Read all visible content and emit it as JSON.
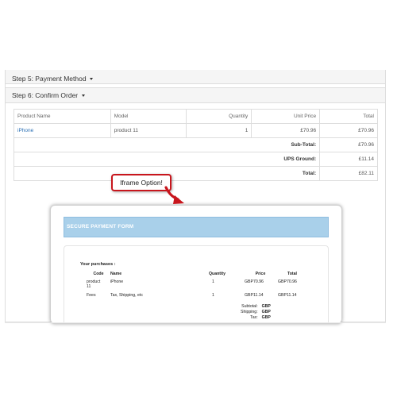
{
  "steps": {
    "step5_label": "Step 5: Payment Method",
    "step6_label": "Step 6: Confirm Order"
  },
  "cart": {
    "columns": [
      "Product Name",
      "Model",
      "Quantity",
      "Unit Price",
      "Total"
    ],
    "row": {
      "name": "iPhone",
      "model": "product 11",
      "quantity": "1",
      "unit_price": "£70.96",
      "total": "£70.96"
    },
    "totals": [
      {
        "label": "Sub-Total:",
        "value": "£70.96"
      },
      {
        "label": "UPS Ground:",
        "value": "£11.14"
      },
      {
        "label": "Total:",
        "value": "£82.11"
      }
    ]
  },
  "callout": {
    "text": "Iframe Option!"
  },
  "iframe": {
    "header": "SECURE PAYMENT FORM",
    "purchases_title": "Your purchases :",
    "columns": [
      "Code",
      "Name",
      "Quantity",
      "Price",
      "Total"
    ],
    "rows": [
      {
        "code": "product 11",
        "name": "iPhone",
        "quantity": "1",
        "price": "GBP70.96",
        "total": "GBP70.96"
      },
      {
        "code": "Fees",
        "name": "Tax, Shipping, etc",
        "quantity": "1",
        "price": "GBP11.14",
        "total": "GBP11.14"
      }
    ],
    "summary": [
      {
        "label": "Subtotal:",
        "value": "GBP"
      },
      {
        "label": "Shipping:",
        "value": "GBP"
      },
      {
        "label": "Tax:",
        "value": "GBP"
      }
    ]
  },
  "colors": {
    "accent_link": "#2a6fb5",
    "callout_border": "#c8161d",
    "form_header": "#a9d0ea"
  }
}
